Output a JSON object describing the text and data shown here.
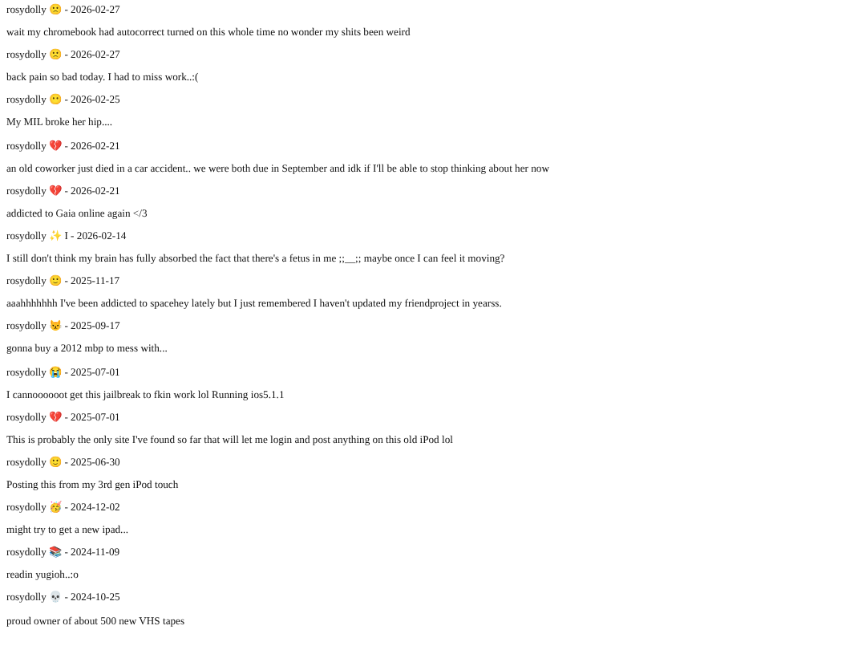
{
  "entries": [
    {
      "header": "rosydolly 🙁 - 2026-02-27",
      "text": "wait my chromebook had autocorrect turned on this whole time no wonder my shits been weird"
    },
    {
      "header": "rosydolly 🙁 - 2026-02-27",
      "text": "back pain so bad today. I had to miss work..:("
    },
    {
      "header": "rosydolly 😶 - 2026-02-25",
      "text": "My MIL broke her hip...."
    },
    {
      "header": "rosydolly 💔 - 2026-02-21",
      "text": "an old coworker just died in a car accident.. we were both due in September and idk if I'll be able to stop thinking about her now"
    },
    {
      "header": "rosydolly 💔 - 2026-02-21",
      "text": "addicted to Gaia online again </3"
    },
    {
      "header": "rosydolly ✨ I - 2026-02-14",
      "text": "I still don't think my brain has fully absorbed the fact that there's a fetus in me ;;__;; maybe once I can feel it moving?"
    },
    {
      "header": "rosydolly 🙂 - 2025-11-17",
      "text": "aaahhhhhhh I've been addicted to spacehey lately but I just remembered I haven't updated my friendproject in yearss."
    },
    {
      "header": "rosydolly 😾 - 2025-09-17",
      "text": "gonna buy a 2012 mbp to mess with..."
    },
    {
      "header": "rosydolly 😭 - 2025-07-01",
      "text": "I cannoooooot get this jailbreak to fkin work lol Running ios5.1.1"
    },
    {
      "header": "rosydolly 💔 - 2025-07-01",
      "text": "This is probably the only site I've found so far that will let me login and post anything on this old iPod lol"
    },
    {
      "header": "rosydolly 🙂 - 2025-06-30",
      "text": "Posting this from my 3rd gen iPod touch"
    },
    {
      "header": "rosydolly 🥳 - 2024-12-02",
      "text": "might try to get a new ipad..."
    },
    {
      "header": "rosydolly 📚 - 2024-11-09",
      "text": "readin yugioh..:o"
    },
    {
      "header": "rosydolly 💀 - 2024-10-25",
      "text": "proud owner of about 500 new VHS tapes"
    }
  ]
}
